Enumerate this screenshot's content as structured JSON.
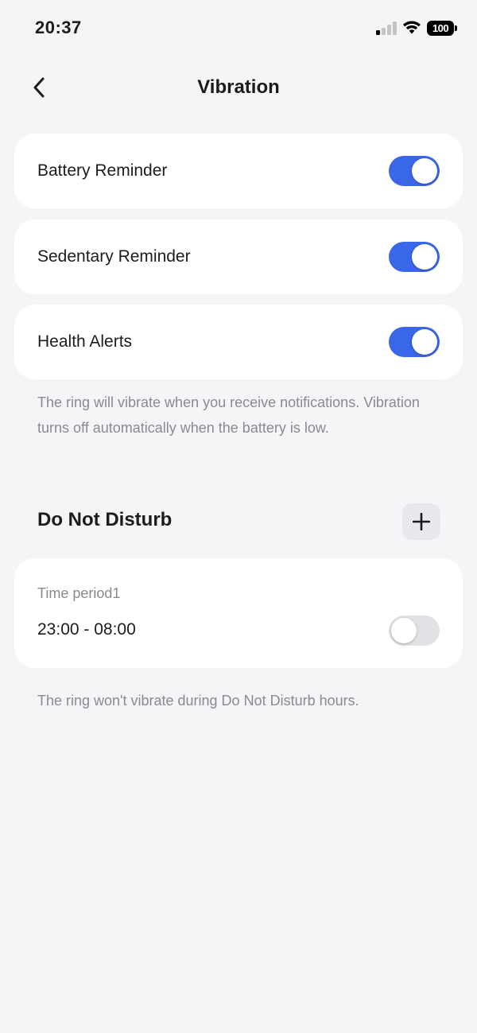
{
  "status_bar": {
    "time": "20:37",
    "battery": "100",
    "signal_icon": "cellular-signal-icon",
    "wifi_icon": "wifi-icon"
  },
  "nav": {
    "title": "Vibration",
    "back_icon": "chevron-left-icon"
  },
  "settings": [
    {
      "label": "Battery Reminder",
      "enabled": true
    },
    {
      "label": "Sedentary Reminder",
      "enabled": true
    },
    {
      "label": "Health Alerts",
      "enabled": true
    }
  ],
  "vibration_note": "The ring will vibrate when you receive notifications. Vibration turns off automatically when the battery is low.",
  "do_not_disturb": {
    "title": "Do Not Disturb",
    "add_icon": "plus-icon",
    "periods": [
      {
        "name": "Time period1",
        "range": "23:00 - 08:00",
        "enabled": false
      }
    ],
    "note": "The ring won't vibrate during Do Not Disturb hours."
  },
  "colors": {
    "background": "#f5f5f8",
    "accent": "#3a66e8",
    "toggle_off": "#e2e2e6",
    "secondary_text": "#8a8a8f"
  }
}
